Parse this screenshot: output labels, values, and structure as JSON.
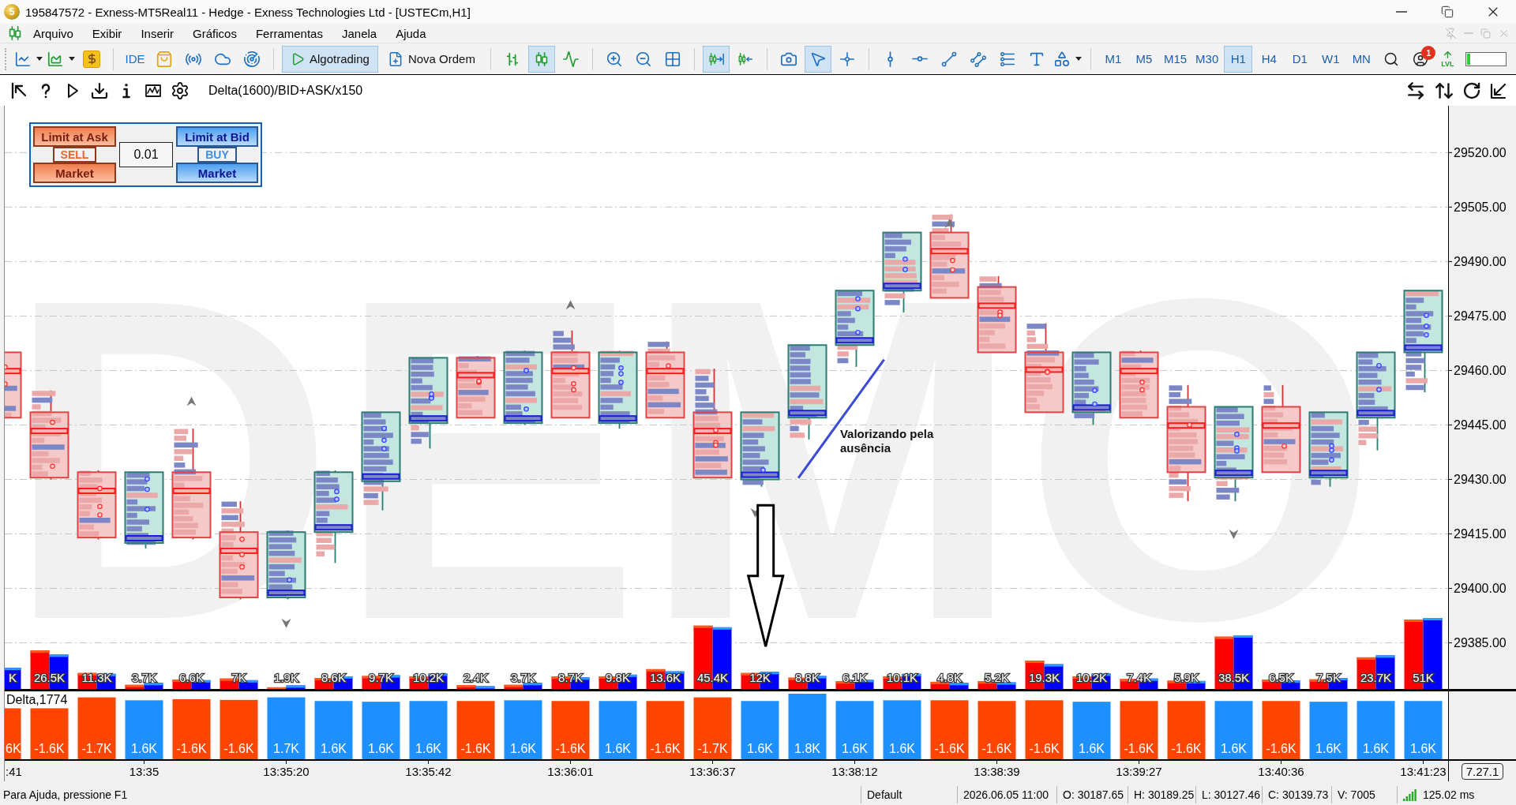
{
  "window": {
    "logo_mark": "5",
    "title": "195847572 - Exness-MT5Real11 - Hedge - Exness Technologies Ltd - [USTECm,H1]"
  },
  "menu": [
    "Arquivo",
    "Exibir",
    "Inserir",
    "Gráficos",
    "Ferramentas",
    "Janela",
    "Ajuda"
  ],
  "toolbar": {
    "ide_label": "IDE",
    "algotrading": {
      "label": "Algotrading",
      "pressed": true
    },
    "new_order": {
      "label": "Nova Ordem"
    },
    "chart_types": [
      {
        "selected": false
      },
      {
        "selected": true
      },
      {
        "selected": false
      }
    ],
    "autoscroll": {
      "pressed": true
    },
    "chart_shift": {
      "pressed": false
    },
    "cursor_modes": [
      {
        "selected": true
      },
      {
        "selected": false
      }
    ],
    "timeframes": [
      {
        "label": "M1",
        "selected": false
      },
      {
        "label": "M5",
        "selected": false
      },
      {
        "label": "M15",
        "selected": false
      },
      {
        "label": "M30",
        "selected": false
      },
      {
        "label": "H1",
        "selected": true
      },
      {
        "label": "H4",
        "selected": false
      },
      {
        "label": "D1",
        "selected": false
      },
      {
        "label": "W1",
        "selected": false
      },
      {
        "label": "MN",
        "selected": false
      }
    ],
    "notification_count": "1",
    "lvl_label": "LVL",
    "meter": {
      "level": 0.07
    }
  },
  "chart_toolbar": {
    "indicator_label": "Delta(1600)/BID+ASK/x150"
  },
  "trade_panel": {
    "sell": {
      "limit_label": "Limit at Ask",
      "side_label": "SELL",
      "market_label": "Market"
    },
    "volume": "0.01",
    "buy": {
      "limit_label": "Limit at Bid",
      "side_label": "BUY",
      "market_label": "Market"
    }
  },
  "chart": {
    "watermark": "DEMO",
    "price_labels": [
      "29520.00",
      "29505.00",
      "29490.00",
      "29475.00",
      "29460.00",
      "29445.00",
      "29430.00",
      "29415.00",
      "29400.00",
      "29385.00"
    ],
    "note": "Valorizando pela ausência",
    "candles": [
      {
        "kind": "bear"
      },
      {
        "kind": "bear"
      },
      {
        "kind": "bear"
      },
      {
        "kind": "bull"
      },
      {
        "kind": "bear"
      },
      {
        "kind": "bear"
      },
      {
        "kind": "bull"
      },
      {
        "kind": "bull"
      },
      {
        "kind": "bull"
      },
      {
        "kind": "bull"
      },
      {
        "kind": "bear"
      },
      {
        "kind": "bull"
      },
      {
        "kind": "bear"
      },
      {
        "kind": "bull"
      },
      {
        "kind": "bear"
      },
      {
        "kind": "bear"
      },
      {
        "kind": "bull"
      },
      {
        "kind": "bull"
      },
      {
        "kind": "bull"
      },
      {
        "kind": "bull"
      },
      {
        "kind": "bear"
      },
      {
        "kind": "bear"
      },
      {
        "kind": "bear"
      },
      {
        "kind": "bull"
      },
      {
        "kind": "bear"
      },
      {
        "kind": "bear"
      },
      {
        "kind": "bull"
      },
      {
        "kind": "bear"
      },
      {
        "kind": "bull"
      },
      {
        "kind": "bull"
      },
      {
        "kind": "bull"
      }
    ]
  },
  "volume_histogram": {
    "labels": [
      "K",
      "26.5K",
      "11.3K",
      "3.7K",
      "6.6K",
      "7K",
      "1.9K",
      "8.6K",
      "9.7K",
      "10.2K",
      "2.4K",
      "3.7K",
      "8.7K",
      "9.8K",
      "13.6K",
      "45.4K",
      "12K",
      "8.8K",
      "6.1K",
      "10.1K",
      "4.8K",
      "5.2K",
      "19.3K",
      "10.2K",
      "7.4K",
      "5.9K",
      "38.5K",
      "6.5K",
      "7.5K",
      "23.7K",
      "51K"
    ]
  },
  "delta_panel": {
    "title": "Delta,1774",
    "bars": [
      {
        "kind": "negative",
        "label": "6K"
      },
      {
        "kind": "negative",
        "label": "-1.6K"
      },
      {
        "kind": "negative",
        "label": "-1.7K"
      },
      {
        "kind": "positive",
        "label": "1.6K"
      },
      {
        "kind": "negative",
        "label": "-1.6K"
      },
      {
        "kind": "negative",
        "label": "-1.6K"
      },
      {
        "kind": "positive",
        "label": "1.7K"
      },
      {
        "kind": "positive",
        "label": "1.6K"
      },
      {
        "kind": "positive",
        "label": "1.6K"
      },
      {
        "kind": "positive",
        "label": "1.6K"
      },
      {
        "kind": "negative",
        "label": "-1.6K"
      },
      {
        "kind": "positive",
        "label": "1.6K"
      },
      {
        "kind": "negative",
        "label": "-1.6K"
      },
      {
        "kind": "positive",
        "label": "1.6K"
      },
      {
        "kind": "negative",
        "label": "-1.6K"
      },
      {
        "kind": "negative",
        "label": "-1.7K"
      },
      {
        "kind": "positive",
        "label": "1.6K"
      },
      {
        "kind": "positive",
        "label": "1.8K"
      },
      {
        "kind": "positive",
        "label": "1.6K"
      },
      {
        "kind": "positive",
        "label": "1.6K"
      },
      {
        "kind": "negative",
        "label": "-1.6K"
      },
      {
        "kind": "negative",
        "label": "-1.6K"
      },
      {
        "kind": "negative",
        "label": "-1.6K"
      },
      {
        "kind": "positive",
        "label": "1.6K"
      },
      {
        "kind": "negative",
        "label": "-1.6K"
      },
      {
        "kind": "negative",
        "label": "-1.6K"
      },
      {
        "kind": "positive",
        "label": "1.6K"
      },
      {
        "kind": "negative",
        "label": "-1.6K"
      },
      {
        "kind": "positive",
        "label": "1.6K"
      },
      {
        "kind": "positive",
        "label": "1.6K"
      },
      {
        "kind": "positive",
        "label": "1.6K"
      }
    ]
  },
  "time_labels": [
    ":41",
    "13:35",
    "13:35:20",
    "13:35:42",
    "13:36:01",
    "13:36:37",
    "13:38:12",
    "13:38:39",
    "13:39:27",
    "13:40:36",
    "13:41:23"
  ],
  "version_label": "7.27.1",
  "status_bar": {
    "help": "Para Ajuda, pressione F1",
    "profile": "Default",
    "datetime": "2026.06.05 11:00",
    "open": "O: 30187.65",
    "high": "H: 30189.25",
    "low": "L: 30127.46",
    "close": "C: 30139.73",
    "volume": "V: 7005",
    "ping": "125.02 ms"
  }
}
